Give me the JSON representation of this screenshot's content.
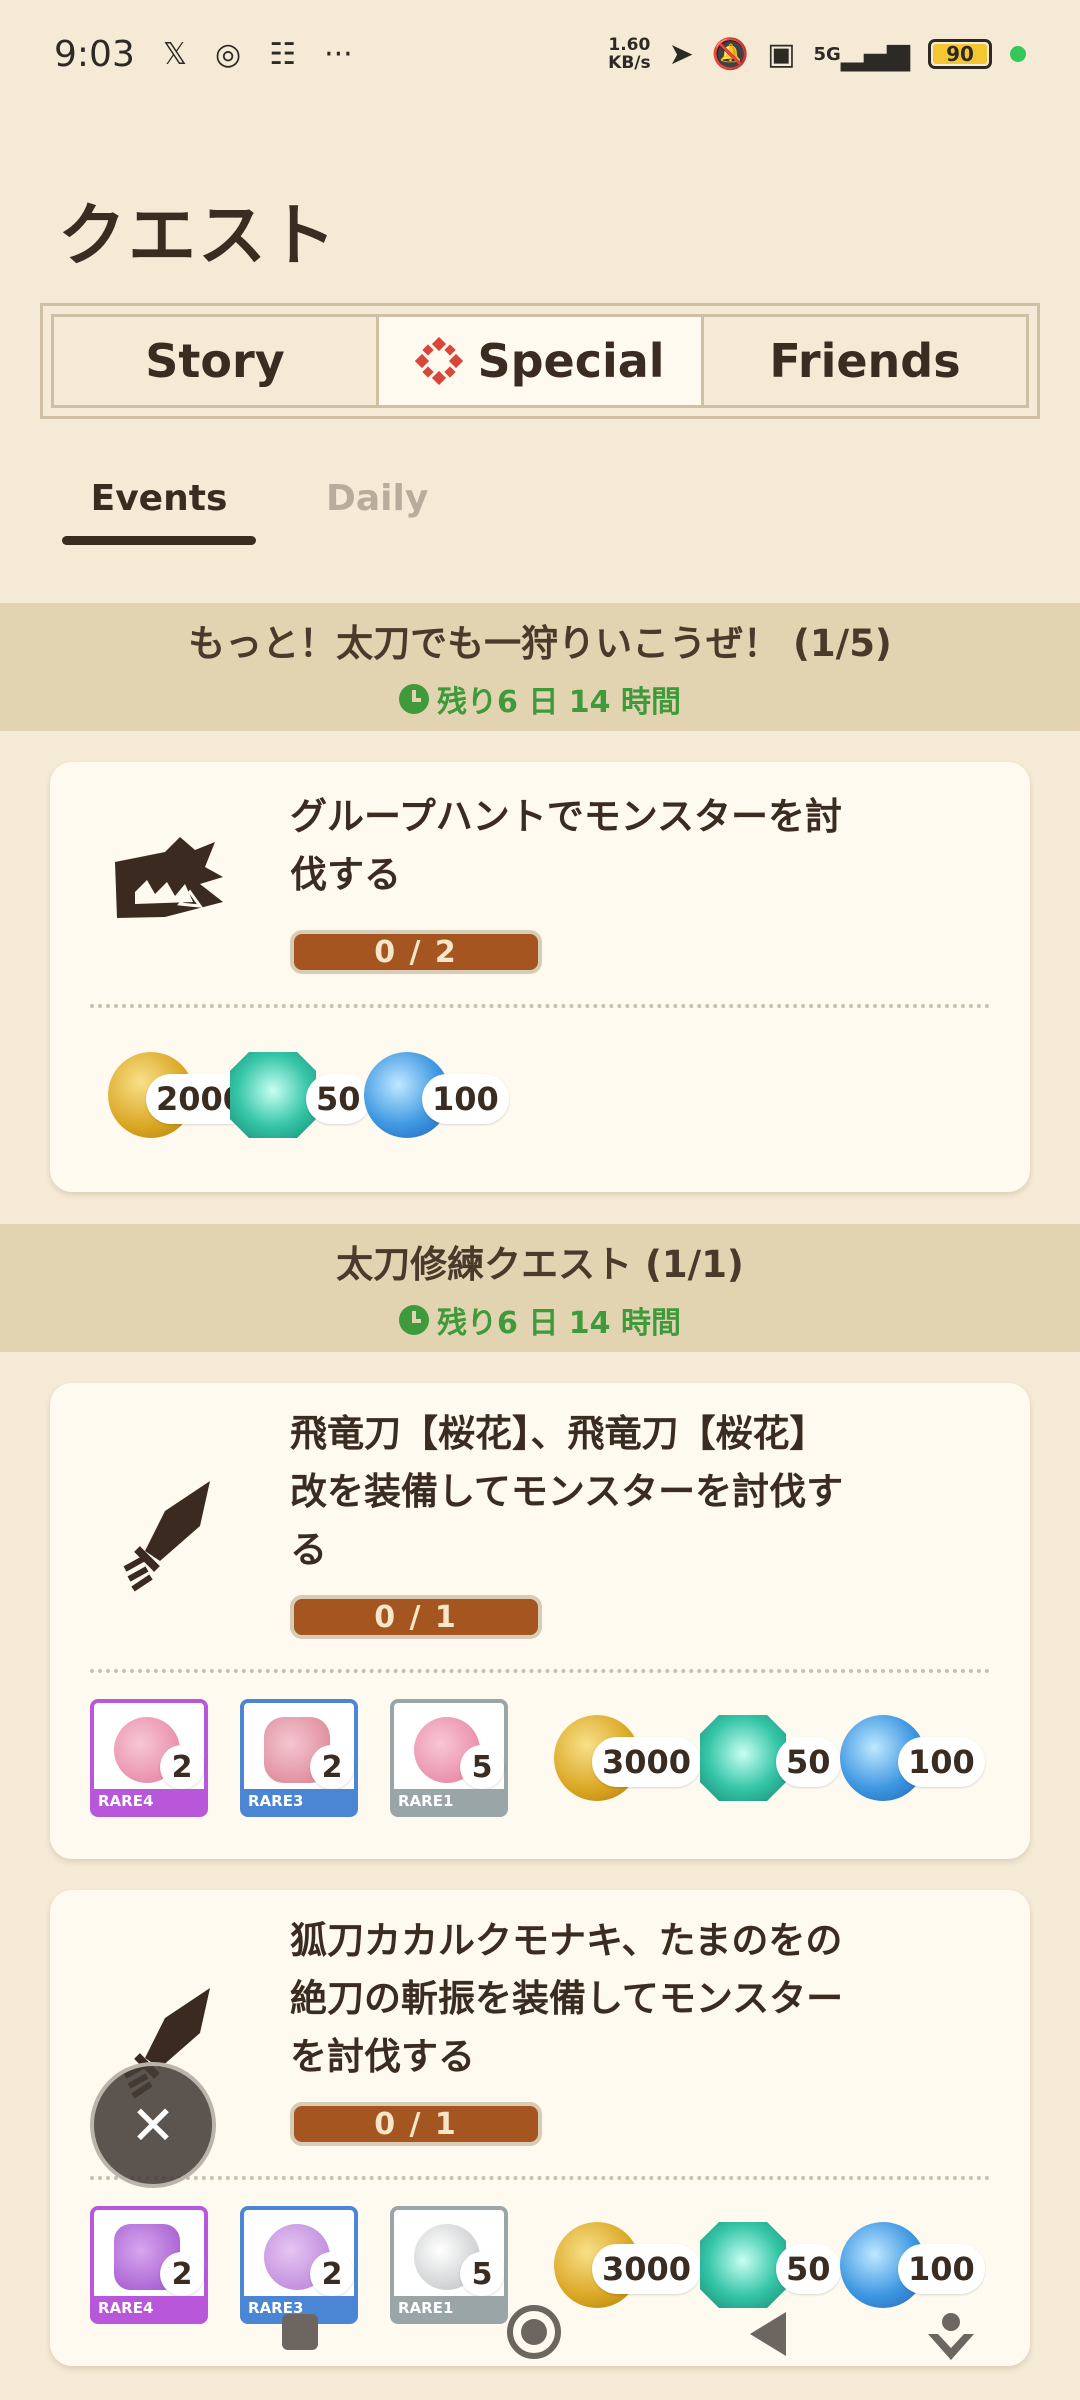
{
  "status_bar": {
    "time": "9:03",
    "net_speed_value": "1.60",
    "net_speed_unit": "KB/s",
    "signal": "5G",
    "battery": "90"
  },
  "page": {
    "title": "クエスト"
  },
  "tabs": [
    {
      "label": "Story",
      "active": false
    },
    {
      "label": "Special",
      "active": true
    },
    {
      "label": "Friends",
      "active": false
    }
  ],
  "subtabs": [
    {
      "label": "Events",
      "active": true
    },
    {
      "label": "Daily",
      "active": false
    }
  ],
  "sections": [
    {
      "title": "もっと！太刀でも一狩りいこうぜ！ (1/5)",
      "remaining": "残り6 日 14 時間",
      "quests": [
        {
          "icon": "monster-fang-icon",
          "description_lines": [
            "グループハントでモンスターを討",
            "伐する"
          ],
          "progress": "0 / 2",
          "rewards": [
            {
              "type": "zenny-coin-icon",
              "qty": "2000"
            },
            {
              "type": "gem-icon",
              "qty": "50"
            },
            {
              "type": "orb-icon",
              "qty": "100"
            }
          ]
        }
      ]
    },
    {
      "title": "太刀修練クエスト (1/1)",
      "remaining": "残り6 日 14 時間",
      "quests": [
        {
          "icon": "long-sword-icon",
          "description_lines": [
            "飛竜刀【桜花】、飛竜刀【桜花】",
            "改を装備してモンスターを討伐す",
            "る"
          ],
          "progress": "0 / 1",
          "items": [
            {
              "rarity": "RARE4",
              "qty": "2",
              "art": "pink-shell"
            },
            {
              "rarity": "RARE3",
              "qty": "2",
              "art": "pink-scale"
            },
            {
              "rarity": "RARE1",
              "qty": "5",
              "art": "pink-shell"
            }
          ],
          "rewards": [
            {
              "type": "zenny-coin-icon",
              "qty": "3000"
            },
            {
              "type": "gem-icon",
              "qty": "50"
            },
            {
              "type": "orb-icon",
              "qty": "100"
            }
          ]
        },
        {
          "icon": "long-sword-icon",
          "description_lines": [
            "狐刀カカルクモナキ、たまのをの",
            "絶刀の斬振を装備してモンスター",
            "を討伐する"
          ],
          "progress": "0 / 1",
          "items": [
            {
              "rarity": "RARE4",
              "qty": "2",
              "art": "purple-figure"
            },
            {
              "rarity": "RARE3",
              "qty": "2",
              "art": "purple-horn"
            },
            {
              "rarity": "RARE1",
              "qty": "5",
              "art": "white-shell"
            }
          ],
          "rewards": [
            {
              "type": "zenny-coin-icon",
              "qty": "3000"
            },
            {
              "type": "gem-icon",
              "qty": "50"
            },
            {
              "type": "orb-icon",
              "qty": "100"
            }
          ]
        }
      ]
    }
  ],
  "colors": {
    "background": "#f4ead6",
    "section_header": "#e2d3b1",
    "progress_fill": "#a45520",
    "remaining_text": "#3f9a3b"
  }
}
